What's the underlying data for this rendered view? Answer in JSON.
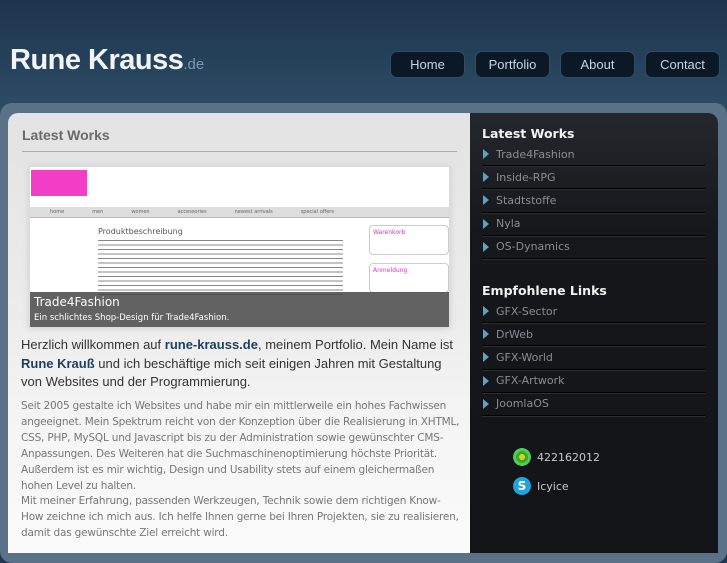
{
  "header": {
    "logo_main": "Rune Krauss",
    "logo_suffix": ".de",
    "nav": [
      "Home",
      "Portfolio",
      "About",
      "Contact"
    ]
  },
  "main": {
    "title": "Latest Works",
    "slide": {
      "title": "Trade4Fashion",
      "subtitle": "Ein schlichtes Shop-Design für Trade4Fashion.",
      "screenshot_heading": "Produktbeschreibung",
      "screenshot_nav": [
        "home",
        "men",
        "women",
        "accessories",
        "newest arrivals",
        "special offers"
      ],
      "screenshot_boxes": [
        "Warenkorb",
        "Anmeldung"
      ]
    },
    "intro": {
      "t1": "Herzlich willkommen auf ",
      "site": "rune-krauss.de",
      "t2": ", meinem Portfolio. Mein Name ist ",
      "name": "Rune Krauß",
      "t3": " und ich beschäftige mich seit einigen Jahren mit Gestaltung von Websites und der Programmierung."
    },
    "p1": "Seit 2005 gestalte ich Websites und habe mir ein mittlerweile ein hohes Fachwissen angeeignet. Mein Spektrum reicht von der Konzeption über die Realisierung in XHTML, CSS, PHP, MySQL und Javascript bis zu der Administration sowie gewünschter CMS-Anpassungen. Des Weiteren hat die Suchmaschinenoptimierung höchste Priorität. Außerdem ist es mir wichtig, Design und Usability stets auf einem gleichermaßen hohen Level zu halten.",
    "p2": "Mit meiner Erfahrung, passenden Werkzeugen, Technik sowie dem richtigen Know-How zeichne ich mich aus. Ich helfe Ihnen gerne bei Ihren Projekten, sie zu realisieren, damit das gewünschte Ziel erreicht wird."
  },
  "sidebar": {
    "works_title": "Latest Works",
    "works": [
      "Trade4Fashion",
      "Inside-RPG",
      "Stadtstoffe",
      "Nyla",
      "OS-Dynamics"
    ],
    "links_title": "Empfohlene Links",
    "links": [
      "GFX-Sector",
      "DrWeb",
      "GFX-World",
      "GFX-Artwork",
      "JoomlaOS"
    ],
    "icq": "422162012",
    "skype": "Icyice"
  }
}
